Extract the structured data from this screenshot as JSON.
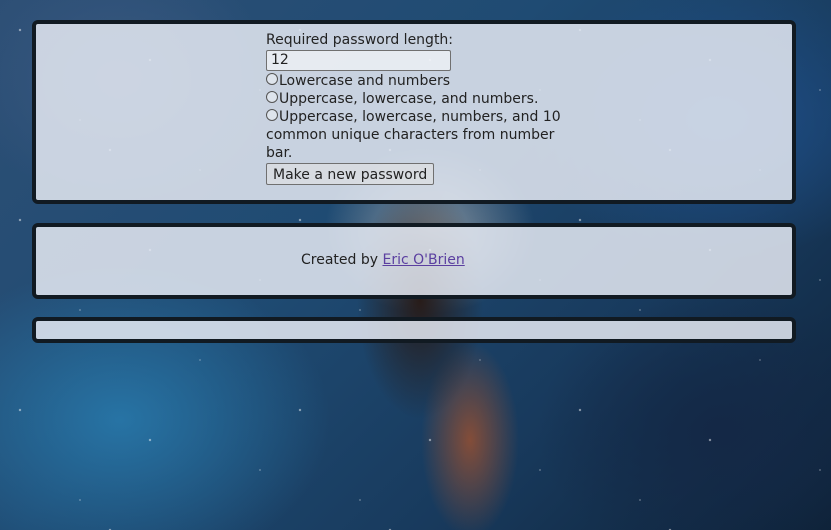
{
  "generator": {
    "length_label": "Required password length:",
    "length_value": "12",
    "options": [
      {
        "label": "Lowercase and numbers"
      },
      {
        "label": "Uppercase, lowercase, and numbers."
      },
      {
        "label": "Uppercase, lowercase, numbers, and 10 common unique characters from number bar."
      }
    ],
    "button_label": "Make a new password"
  },
  "footer": {
    "created_by_text": "Created by",
    "author_link": "Eric O'Brien"
  }
}
